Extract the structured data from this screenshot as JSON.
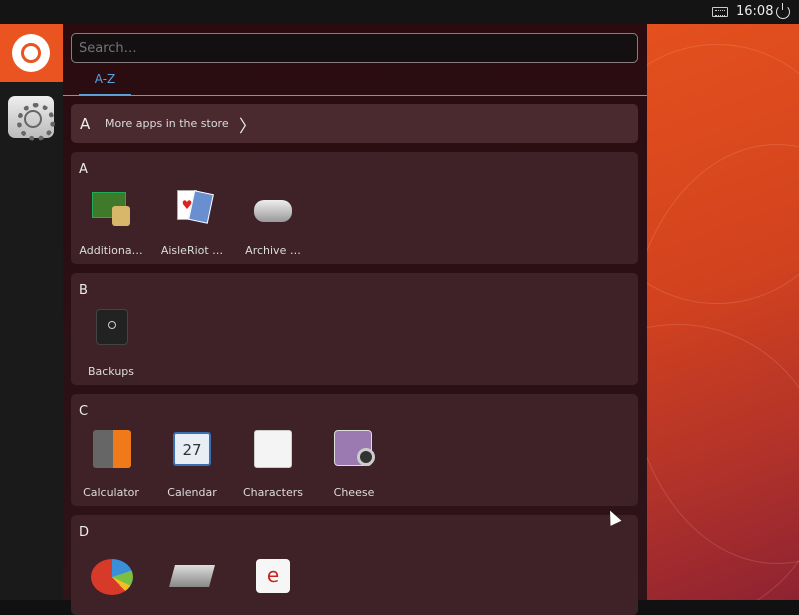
{
  "topbar": {
    "clock": "16:08",
    "keyboard_icon": "keyboard-icon",
    "power_icon": "power-icon"
  },
  "launcher": {
    "items": [
      {
        "name": "Ubuntu dash",
        "icon": "ubuntu-logo-icon"
      },
      {
        "name": "System Settings",
        "icon": "settings-icon"
      }
    ]
  },
  "dash": {
    "search_placeholder": "Search…",
    "tab": "A-Z",
    "store_label": "More apps in the store",
    "sections": [
      {
        "letter": "A",
        "apps": [
          "Additiona…",
          "AisleRiot …",
          "Archive …"
        ]
      },
      {
        "letter": "B",
        "apps": [
          "Backups"
        ]
      },
      {
        "letter": "C",
        "apps": [
          "Calculator",
          "Calendar",
          "Characters",
          "Cheese"
        ]
      },
      {
        "letter": "D",
        "apps": [
          "",
          "",
          ""
        ]
      }
    ],
    "calendar_day": "27"
  },
  "colors": {
    "accent": "#e95420",
    "tab": "#5aa3d8"
  }
}
